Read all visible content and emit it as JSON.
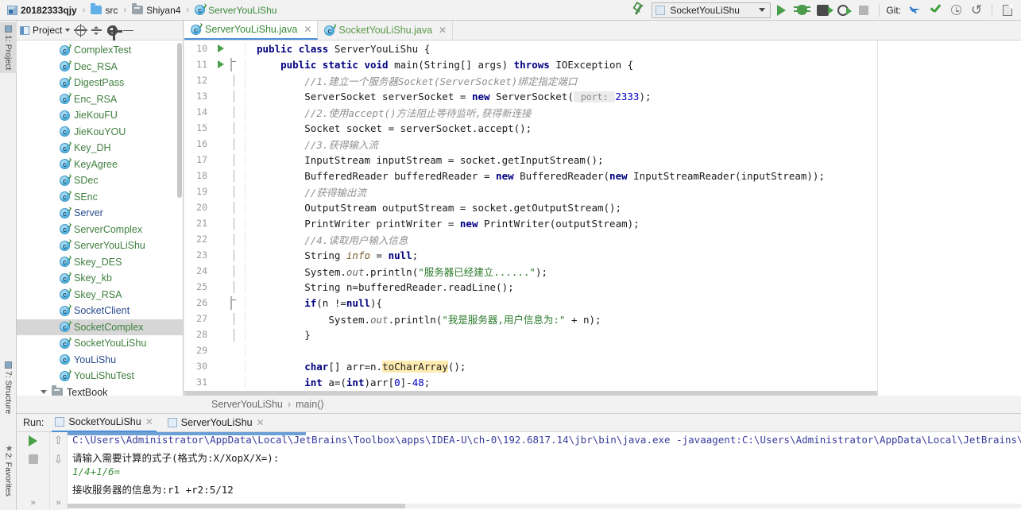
{
  "breadcrumbs": [
    {
      "label": "20182333qjy",
      "icon": "project-icon",
      "style": "bold"
    },
    {
      "label": "src",
      "icon": "folder-icon",
      "style": "plain"
    },
    {
      "label": "Shiyan4",
      "icon": "folder-grey-icon",
      "style": "plain"
    },
    {
      "label": "ServerYouLiShu",
      "icon": "java-class-icon",
      "style": "green"
    }
  ],
  "toolbar": {
    "run_config": "SocketYouLiShu",
    "run_icon": "run-icon",
    "debug_icon": "debug-icon",
    "run_with_icon": "run-with-icon",
    "coverage_icon": "coverage-icon",
    "stop_icon": "stop-icon",
    "git_label": "Git:",
    "git_update_icon": "update-project-icon",
    "git_commit_icon": "commit-icon",
    "git_history_icon": "history-icon",
    "git_revert_icon": "revert-icon",
    "file_icon": "file-icon",
    "wrench_icon": "build-icon"
  },
  "left_strip": {
    "tabs": [
      {
        "label": "1: Project",
        "active": true
      },
      {
        "label": "7: Structure",
        "active": false
      },
      {
        "label": "2: Favorites",
        "active": false
      }
    ]
  },
  "project_panel": {
    "title": "Project",
    "icons": [
      "locate-icon",
      "collapse-all-icon",
      "settings-icon",
      "hide-icon"
    ],
    "tree": [
      {
        "label": "ComplexTest",
        "icon": "java-class-icon",
        "color": "green",
        "selected": false
      },
      {
        "label": "Dec_RSA",
        "icon": "java-class-icon",
        "color": "green",
        "selected": false
      },
      {
        "label": "DigestPass",
        "icon": "java-class-icon",
        "color": "green",
        "selected": false
      },
      {
        "label": "Enc_RSA",
        "icon": "java-class-icon",
        "color": "green",
        "selected": false
      },
      {
        "label": "JieKouFU",
        "icon": "java-interface-icon",
        "color": "green",
        "selected": false
      },
      {
        "label": "JieKouYOU",
        "icon": "java-interface-icon",
        "color": "green",
        "selected": false
      },
      {
        "label": "Key_DH",
        "icon": "java-class-icon",
        "color": "green",
        "selected": false
      },
      {
        "label": "KeyAgree",
        "icon": "java-class-icon",
        "color": "green",
        "selected": false
      },
      {
        "label": "SDec",
        "icon": "java-class-icon",
        "color": "green",
        "selected": false
      },
      {
        "label": "SEnc",
        "icon": "java-class-icon",
        "color": "green",
        "selected": false
      },
      {
        "label": "Server",
        "icon": "java-class-icon",
        "color": "blue",
        "selected": false
      },
      {
        "label": "ServerComplex",
        "icon": "java-class-icon",
        "color": "green",
        "selected": false
      },
      {
        "label": "ServerYouLiShu",
        "icon": "java-class-icon",
        "color": "green",
        "selected": false
      },
      {
        "label": "Skey_DES",
        "icon": "java-class-icon",
        "color": "green",
        "selected": false
      },
      {
        "label": "Skey_kb",
        "icon": "java-class-icon",
        "color": "green",
        "selected": false
      },
      {
        "label": "Skey_RSA",
        "icon": "java-class-icon",
        "color": "green",
        "selected": false
      },
      {
        "label": "SocketClient",
        "icon": "java-class-icon",
        "color": "blue",
        "selected": false
      },
      {
        "label": "SocketComplex",
        "icon": "java-class-icon",
        "color": "green",
        "selected": true
      },
      {
        "label": "SocketYouLiShu",
        "icon": "java-class-icon",
        "color": "green",
        "selected": false
      },
      {
        "label": "YouLiShu",
        "icon": "java-interface-icon",
        "color": "blue",
        "selected": false
      },
      {
        "label": "YouLiShuTest",
        "icon": "java-class-icon",
        "color": "green",
        "selected": false
      }
    ],
    "folder_row": {
      "label": "TextBook",
      "icon": "folder-grey-icon"
    }
  },
  "editor": {
    "tabs": [
      {
        "label": "ServerYouLiShu.java",
        "active": true,
        "icon": "java-class-icon"
      },
      {
        "label": "SocketYouLiShu.java",
        "active": false,
        "icon": "java-class-icon"
      }
    ],
    "first_line_number": 10,
    "lines": [
      {
        "n": "10",
        "gutter": "run",
        "fold": "",
        "indent": 0,
        "tokens": [
          {
            "t": "public ",
            "c": "kw"
          },
          {
            "t": "class ",
            "c": "kw"
          },
          {
            "t": "ServerYouLiShu {",
            "c": "plain"
          }
        ]
      },
      {
        "n": "11",
        "gutter": "run",
        "fold": "open",
        "indent": 1,
        "tokens": [
          {
            "t": "public ",
            "c": "kw"
          },
          {
            "t": "static ",
            "c": "kw"
          },
          {
            "t": "void ",
            "c": "kw"
          },
          {
            "t": "main(String[] args) ",
            "c": "plain"
          },
          {
            "t": "throws ",
            "c": "kw"
          },
          {
            "t": "IOException {",
            "c": "plain"
          }
        ]
      },
      {
        "n": "12",
        "gutter": "",
        "fold": "mid",
        "indent": 2,
        "tokens": [
          {
            "t": "//1.建立一个服务器Socket(ServerSocket)绑定指定端口",
            "c": "cm"
          }
        ]
      },
      {
        "n": "13",
        "gutter": "",
        "fold": "mid",
        "indent": 2,
        "tokens": [
          {
            "t": "ServerSocket serverSocket = ",
            "c": "plain"
          },
          {
            "t": "new ",
            "c": "kw"
          },
          {
            "t": "ServerSocket(",
            "c": "plain"
          },
          {
            "t": " port: ",
            "c": "hint"
          },
          {
            "t": "2333",
            "c": "num"
          },
          {
            "t": ");",
            "c": "plain"
          }
        ]
      },
      {
        "n": "14",
        "gutter": "",
        "fold": "mid",
        "indent": 2,
        "tokens": [
          {
            "t": "//2.使用accept()方法阻止等待监听,获得新连接",
            "c": "cm"
          }
        ]
      },
      {
        "n": "15",
        "gutter": "",
        "fold": "mid",
        "indent": 2,
        "tokens": [
          {
            "t": "Socket socket = serverSocket.accept();",
            "c": "plain"
          }
        ]
      },
      {
        "n": "16",
        "gutter": "",
        "fold": "mid",
        "indent": 2,
        "tokens": [
          {
            "t": "//3.获得输入流",
            "c": "cm"
          }
        ]
      },
      {
        "n": "17",
        "gutter": "",
        "fold": "mid",
        "indent": 2,
        "tokens": [
          {
            "t": "InputStream inputStream = socket.getInputStream();",
            "c": "plain"
          }
        ]
      },
      {
        "n": "18",
        "gutter": "",
        "fold": "mid",
        "indent": 2,
        "tokens": [
          {
            "t": "BufferedReader bufferedReader = ",
            "c": "plain"
          },
          {
            "t": "new ",
            "c": "kw"
          },
          {
            "t": "BufferedReader(",
            "c": "plain"
          },
          {
            "t": "new ",
            "c": "kw"
          },
          {
            "t": "InputStreamReader(inputStream));",
            "c": "plain"
          }
        ]
      },
      {
        "n": "19",
        "gutter": "",
        "fold": "mid",
        "indent": 2,
        "tokens": [
          {
            "t": "//获得输出流",
            "c": "cm"
          }
        ]
      },
      {
        "n": "20",
        "gutter": "",
        "fold": "mid",
        "indent": 2,
        "tokens": [
          {
            "t": "OutputStream outputStream = socket.getOutputStream();",
            "c": "plain"
          }
        ]
      },
      {
        "n": "21",
        "gutter": "",
        "fold": "mid",
        "indent": 2,
        "tokens": [
          {
            "t": "PrintWriter printWriter = ",
            "c": "plain"
          },
          {
            "t": "new ",
            "c": "kw"
          },
          {
            "t": "PrintWriter(outputStream);",
            "c": "plain"
          }
        ]
      },
      {
        "n": "22",
        "gutter": "",
        "fold": "mid",
        "indent": 2,
        "tokens": [
          {
            "t": "//4.读取用户输入信息",
            "c": "cm"
          }
        ]
      },
      {
        "n": "23",
        "gutter": "",
        "fold": "mid",
        "indent": 2,
        "tokens": [
          {
            "t": "String ",
            "c": "plain"
          },
          {
            "t": "info",
            "c": "fld"
          },
          {
            "t": " = ",
            "c": "plain"
          },
          {
            "t": "null",
            "c": "kw"
          },
          {
            "t": ";",
            "c": "plain"
          }
        ]
      },
      {
        "n": "24",
        "gutter": "",
        "fold": "mid",
        "indent": 2,
        "tokens": [
          {
            "t": "System.",
            "c": "plain"
          },
          {
            "t": "out",
            "c": "stat"
          },
          {
            "t": ".println(",
            "c": "plain"
          },
          {
            "t": "\"服务器已经建立......\"",
            "c": "st"
          },
          {
            "t": ");",
            "c": "plain"
          }
        ]
      },
      {
        "n": "25",
        "gutter": "",
        "fold": "mid",
        "indent": 2,
        "tokens": [
          {
            "t": "String n=bufferedReader.readLine();",
            "c": "plain"
          }
        ]
      },
      {
        "n": "26",
        "gutter": "",
        "fold": "open",
        "indent": 2,
        "tokens": [
          {
            "t": "if",
            "c": "kw"
          },
          {
            "t": "(n !=",
            "c": "plain"
          },
          {
            "t": "null",
            "c": "kw"
          },
          {
            "t": "){",
            "c": "plain"
          }
        ]
      },
      {
        "n": "27",
        "gutter": "",
        "fold": "mid",
        "indent": 3,
        "tokens": [
          {
            "t": "System.",
            "c": "plain"
          },
          {
            "t": "out",
            "c": "stat"
          },
          {
            "t": ".println(",
            "c": "plain"
          },
          {
            "t": "\"我是服务器,用户信息为:\"",
            "c": "st"
          },
          {
            "t": " + n);",
            "c": "plain"
          }
        ]
      },
      {
        "n": "28",
        "gutter": "",
        "fold": "end",
        "indent": 2,
        "tokens": [
          {
            "t": "}",
            "c": "plain"
          }
        ]
      },
      {
        "n": "29",
        "gutter": "",
        "fold": "",
        "indent": 2,
        "tokens": [
          {
            "t": "",
            "c": "plain"
          }
        ]
      },
      {
        "n": "30",
        "gutter": "",
        "fold": "",
        "indent": 2,
        "tokens": [
          {
            "t": "char",
            "c": "kw"
          },
          {
            "t": "[] arr=n.",
            "c": "plain"
          },
          {
            "t": "toCharArray",
            "c": "hl"
          },
          {
            "t": "();",
            "c": "plain"
          }
        ]
      },
      {
        "n": "31",
        "gutter": "",
        "fold": "",
        "indent": 2,
        "tokens": [
          {
            "t": "int ",
            "c": "kw"
          },
          {
            "t": "a=(",
            "c": "plain"
          },
          {
            "t": "int",
            "c": "kw"
          },
          {
            "t": ")arr[",
            "c": "plain"
          },
          {
            "t": "0",
            "c": "num"
          },
          {
            "t": "]-",
            "c": "plain"
          },
          {
            "t": "48",
            "c": "num"
          },
          {
            "t": ";",
            "c": "plain"
          }
        ]
      }
    ]
  },
  "status_breadcrumb": {
    "parts": [
      "ServerYouLiShu",
      "main()"
    ],
    "separator": "›"
  },
  "run_panel": {
    "label": "Run:",
    "tabs": [
      {
        "label": "SocketYouLiShu",
        "active": true
      },
      {
        "label": "ServerYouLiShu",
        "active": false
      }
    ],
    "tool_icons": [
      "rerun-icon",
      "stop-icon",
      "scroll-up-icon",
      "scroll-down-icon",
      "more-icon"
    ],
    "console": [
      {
        "text": "C:\\Users\\Administrator\\AppData\\Local\\JetBrains\\Toolbox\\apps\\IDEA-U\\ch-0\\192.6817.14\\jbr\\bin\\java.exe -javaagent:C:\\Users\\Administrator\\AppData\\Local\\JetBrains\\Toolbox\\apps\\",
        "kind": "path"
      },
      {
        "text": "请输入需要计算的式子(格式为:X/XopX/X=):",
        "kind": "out"
      },
      {
        "text": "1/4+1/6=",
        "kind": "in"
      },
      {
        "text": "接收服务器的信息为:r1 +r2:5/12",
        "kind": "out"
      }
    ]
  },
  "colors": {
    "accent": "#4a90d9",
    "keyword": "#000080",
    "string": "#2a7a2a",
    "comment": "#909090",
    "selection": "#d6d6d6",
    "highlight": "#fdebb0"
  }
}
